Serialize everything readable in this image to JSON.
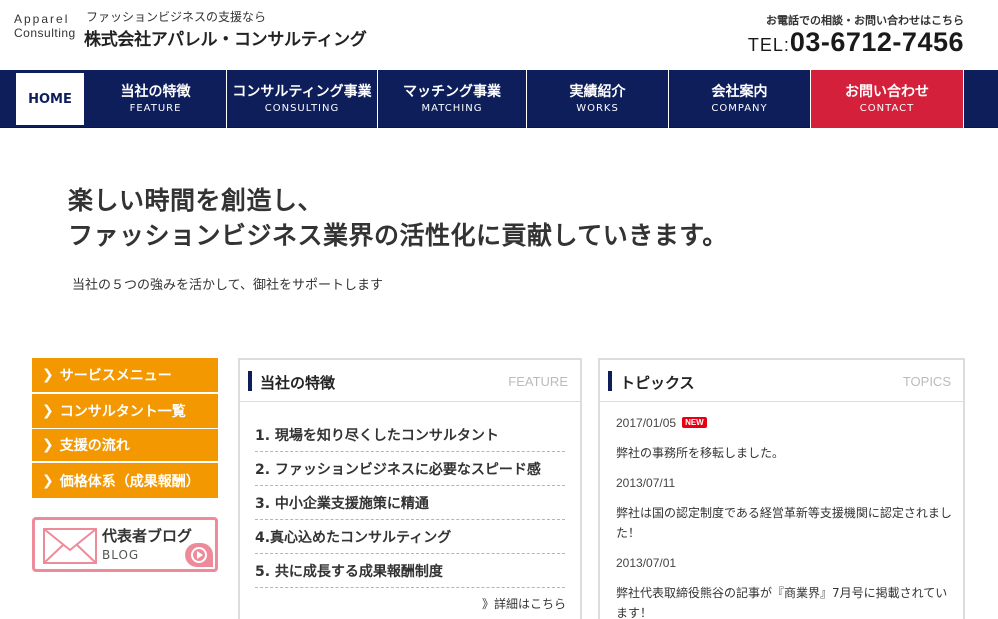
{
  "header": {
    "logo_line1": "Apparel",
    "logo_line2": "Consulting",
    "tagline": "ファッションビジネスの支援なら",
    "company_name": "株式会社アパレル・コンサルティング",
    "contact_note": "お電話での相談・お問い合わせはこちら",
    "phone_prefix": "TEL:",
    "phone_number": "03-6712-7456"
  },
  "nav": {
    "home": "HOME",
    "items": [
      {
        "jp": "当社の特徴",
        "en": "FEATURE"
      },
      {
        "jp": "コンサルティング事業",
        "en": "CONSULTING"
      },
      {
        "jp": "マッチング事業",
        "en": "MATCHING"
      },
      {
        "jp": "実績紹介",
        "en": "WORKS"
      },
      {
        "jp": "会社案内",
        "en": "COMPANY"
      },
      {
        "jp": "お問い合わせ",
        "en": "CONTACT"
      }
    ]
  },
  "hero": {
    "line1": "楽しい時間を創造し、",
    "line2": "ファッションビジネス業界の活性化に貢献していきます。",
    "sub": "当社の５つの強みを活かして、御社をサポートします"
  },
  "side_menu": {
    "items": [
      "サービスメニュー",
      "コンサルタント一覧",
      "支援の流れ",
      "価格体系（成果報酬）"
    ],
    "blog_title": "代表者ブログ",
    "blog_en": "BLOG"
  },
  "feature_panel": {
    "title": "当社の特徴",
    "title_en": "FEATURE",
    "items": [
      "1. 現場を知り尽くしたコンサルタント",
      "2. ファッションビジネスに必要なスピード感",
      "3. 中小企業支援施策に精通",
      "4.真心込めたコンサルティング",
      "5. 共に成長する成果報酬制度"
    ],
    "more": "詳細はこちら"
  },
  "topics_panel": {
    "title": "トピックス",
    "title_en": "TOPICS",
    "new_label": "NEW",
    "entries": [
      {
        "date": "2017/01/05",
        "text": "弊社の事務所を移転しました。"
      },
      {
        "date": "2013/07/11",
        "text": "弊社は国の認定制度である経営革新等支援機関に認定されました！"
      },
      {
        "date": "2013/07/01",
        "text": "弊社代表取締役熊谷の記事が『商業界』7月号に掲載されています！"
      }
    ]
  },
  "colors": {
    "navy": "#0e1e5b",
    "contact_red": "#d5203b",
    "orange": "#f39800",
    "blog_pink": "#ee8b9a",
    "new_red": "#e60012"
  },
  "icons": [
    "chevron-right-icon",
    "envelope-icon",
    "arrow-right-icon"
  ]
}
